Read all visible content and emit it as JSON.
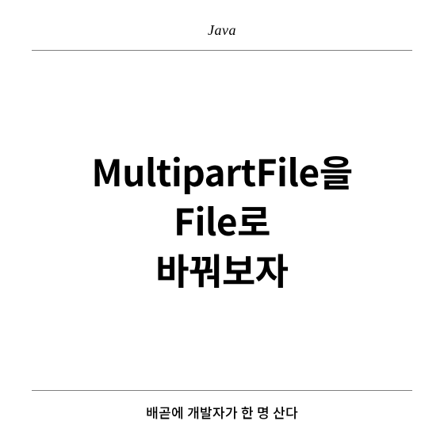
{
  "header": {
    "category": "Java"
  },
  "title": {
    "line1": "MultipartFile을",
    "line2": "File로",
    "line3": "바꿔보자"
  },
  "footer": {
    "tagline": "배곧에 개발자가 한 명 산다"
  }
}
